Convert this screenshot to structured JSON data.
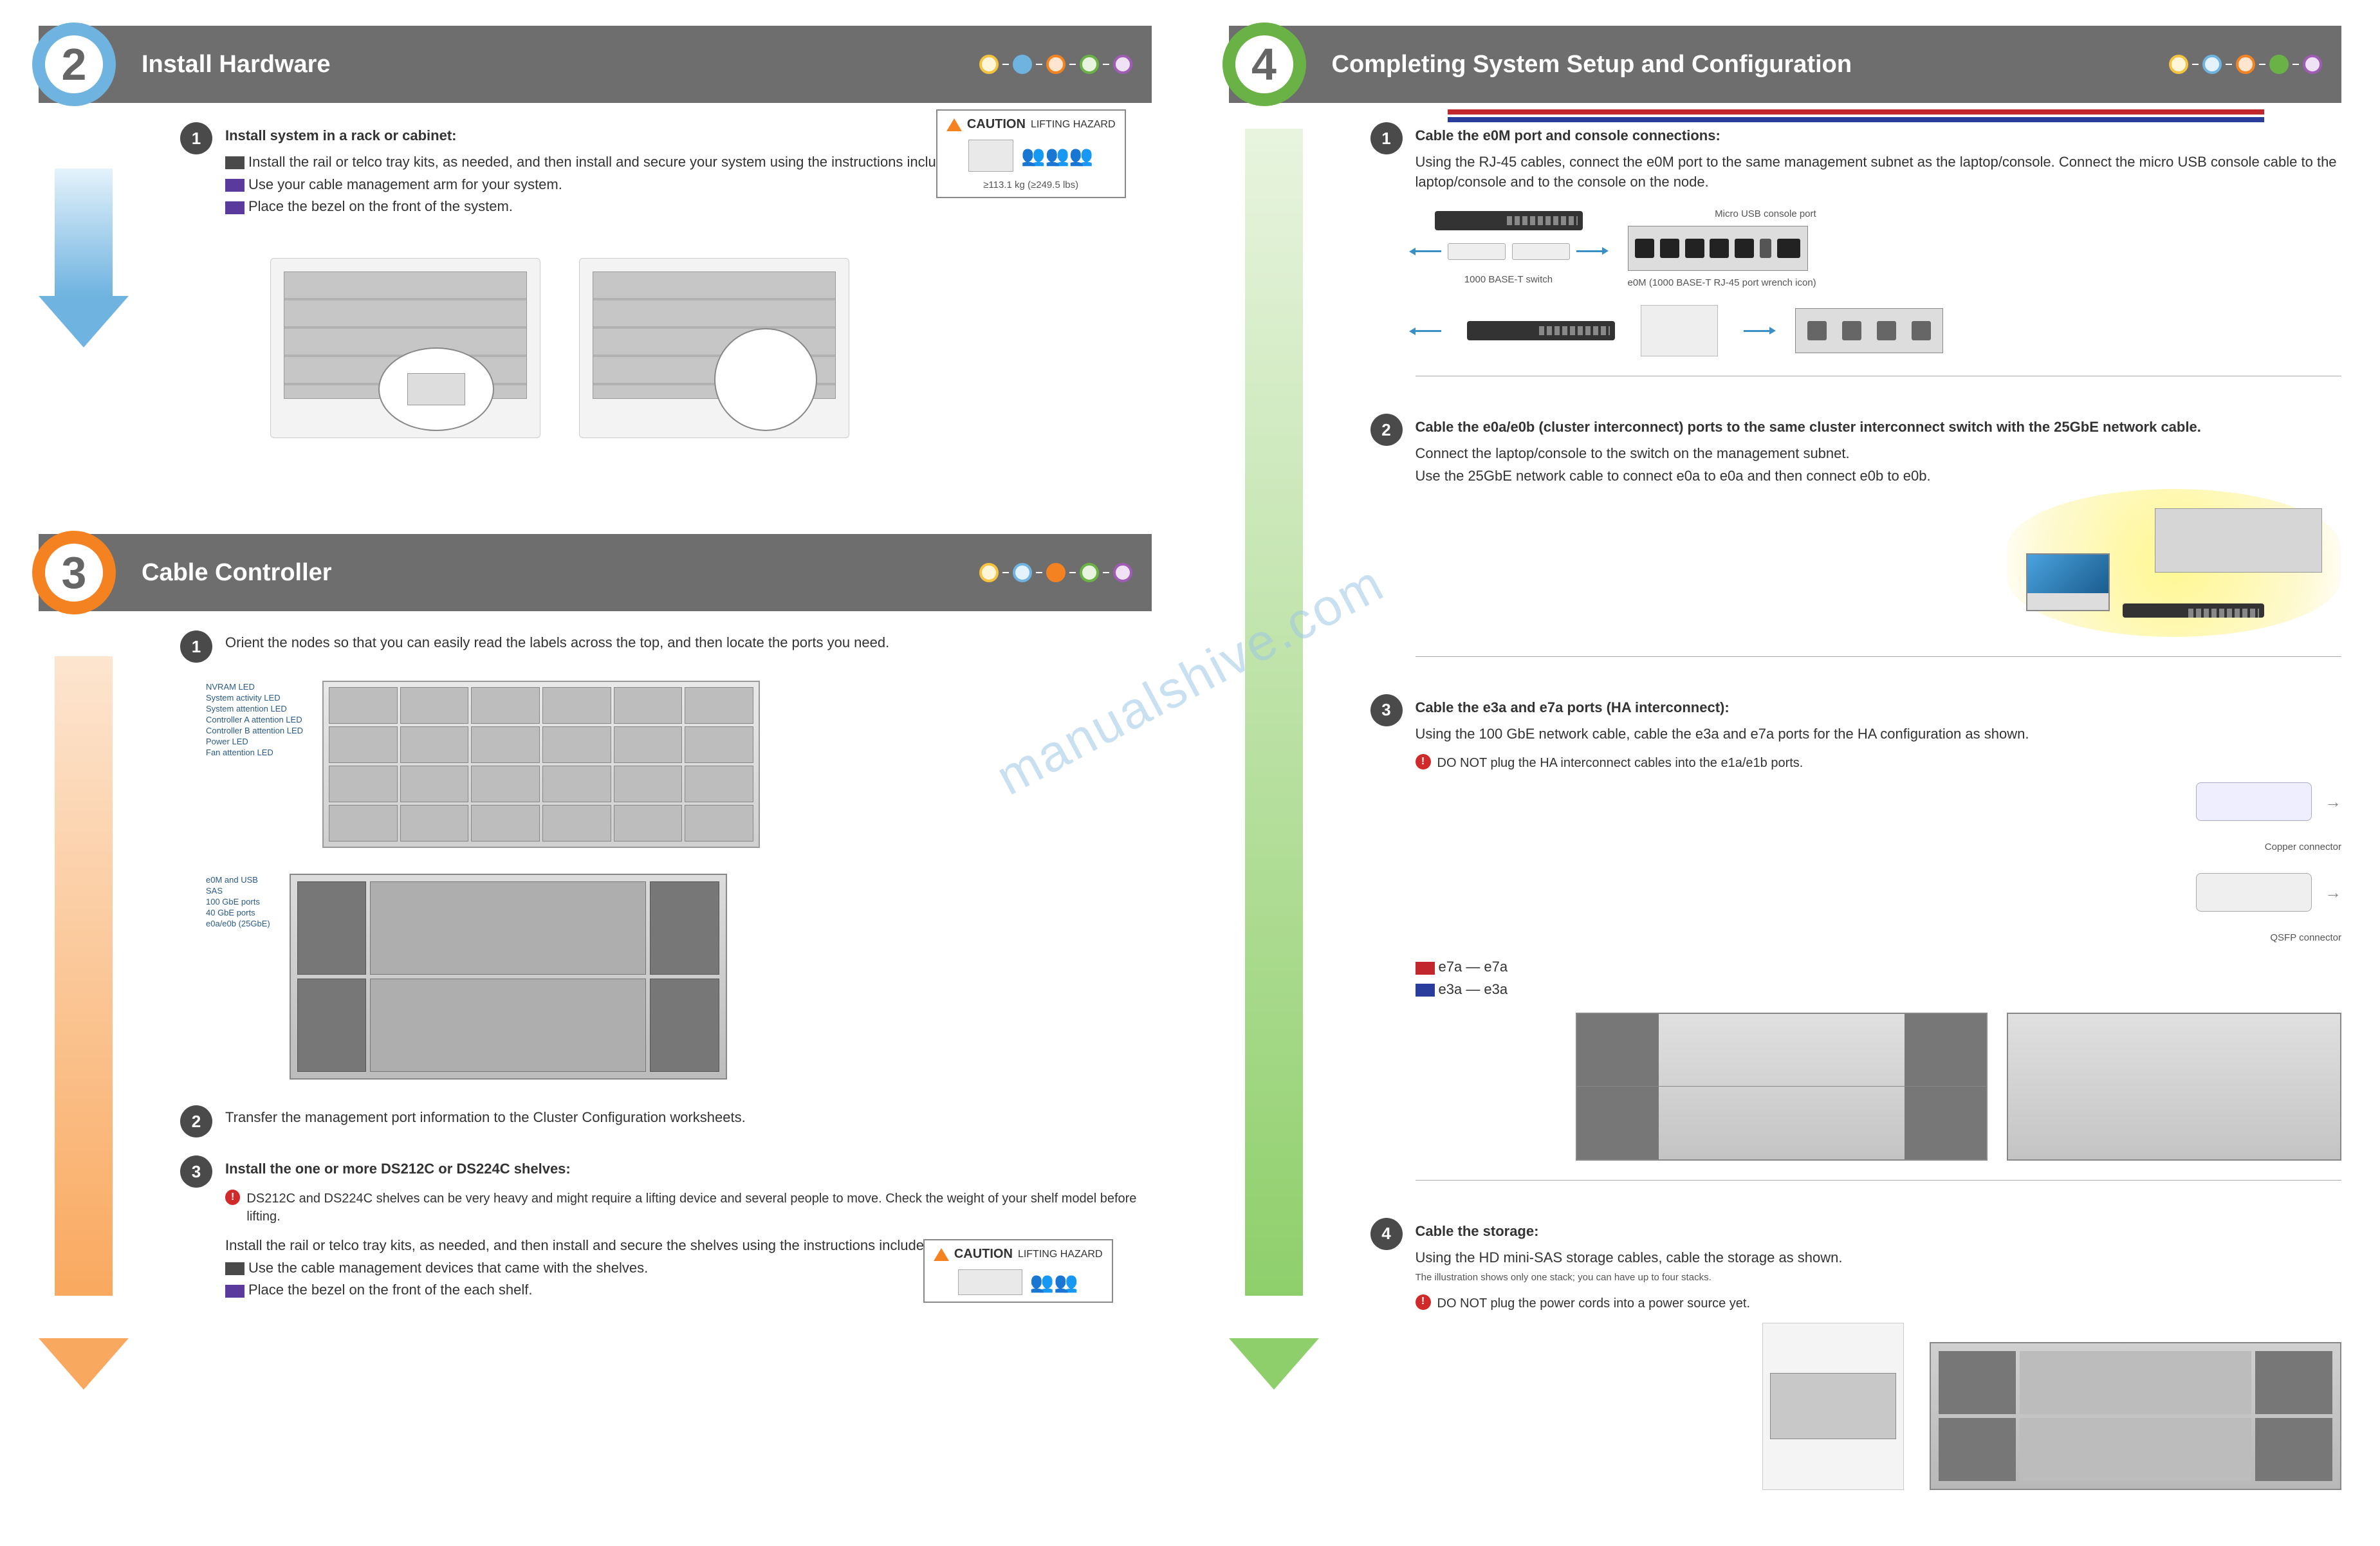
{
  "watermark": "manualshive.com",
  "section2": {
    "number": "2",
    "title": "Install Hardware",
    "sub1": {
      "num": "1",
      "heading": "Install system in a rack or cabinet:",
      "line1_seg_text": "Install the rail or telco tray kits, as needed, and then install and secure your system using the instructions included with the kit.",
      "line2_seg_text": "Use your cable management arm for your system.",
      "line3_seg_text": "Place the bezel on the front of the system.",
      "warn_label": "CAUTION",
      "warn_sub": "LIFTING HAZARD",
      "warn_weight": "≥113.1 kg (≥249.5 lbs)"
    }
  },
  "section3": {
    "number": "3",
    "title": "Cable Controller",
    "sub1": {
      "num": "1",
      "heading": "Orient the nodes so that you can easily read the labels across the top, and then locate the ports you need.",
      "front_labels": [
        "NVRAM LED",
        "System activity LED",
        "System attention LED",
        "Controller A attention LED",
        "Controller B attention LED",
        "Power LED",
        "Fan attention LED"
      ],
      "rear_labels": [
        "e0M and USB",
        "SAS",
        "100 GbE ports",
        "40 GbE ports",
        "e0a/e0b (25GbE)"
      ]
    },
    "sub2": {
      "num": "2",
      "heading": "Transfer the management port information to the Cluster Configuration worksheets."
    },
    "sub3": {
      "num": "3",
      "heading": "Install the one or more DS212C or DS224C shelves:",
      "body1": "Install the rail or telco tray kits, as needed, and then install and secure the shelves using the instructions included with the kit.",
      "seg_dark": "Use the cable management devices that came with the shelves.",
      "seg_purple": "Place the bezel on the front of the each shelf.",
      "alert": "DS212C and DS224C shelves can be very heavy and might require a lifting device and several people to move. Check the weight of your shelf model before lifting.",
      "warn_label": "CAUTION",
      "warn_sub": "LIFTING HAZARD"
    }
  },
  "section4": {
    "number": "4",
    "title": "Completing System Setup and Configuration",
    "sub1": {
      "num": "1",
      "heading": "Cable the e0M port and console connections:",
      "body": "Using the RJ-45 cables, connect the e0M port to the same management subnet as the laptop/console. Connect the micro USB console cable to the laptop/console and to the console on the node.",
      "legend_1000": "1000 BASE-T switch",
      "legend_port": "e0M (1000 BASE-T RJ-45 port wrench icon)",
      "legend_console": "Micro USB console port"
    },
    "sub2": {
      "num": "2",
      "heading": "Cable the e0a/e0b (cluster interconnect) ports to the same cluster interconnect switch with the 25GbE network cable.",
      "body1": "Connect the laptop/console to the switch on the management subnet.",
      "body2": "Use the 25GbE network cable to connect e0a to e0a and then connect e0b to e0b."
    },
    "sub3": {
      "num": "3",
      "heading": "Cable the e3a and e7a ports (HA interconnect):",
      "body": "Using the 100 GbE network cable, cable the e3a and e7a ports for the HA configuration as shown.",
      "alert": "DO NOT plug the HA interconnect cables into the e1a/e1b ports.",
      "seg_red_text": "e7a — e7a",
      "seg_blue_text": "e3a — e3a",
      "leg_copper": "Copper connector",
      "leg_fiber": "QSFP connector"
    },
    "sub4": {
      "num": "4",
      "heading": "Cable the storage:",
      "body": "Using the HD mini-SAS storage cables, cable the storage as shown.",
      "alert2": "DO NOT plug the power cords into a power source yet.",
      "sasnote": "The illustration shows only one stack; you can have up to four stacks."
    }
  }
}
